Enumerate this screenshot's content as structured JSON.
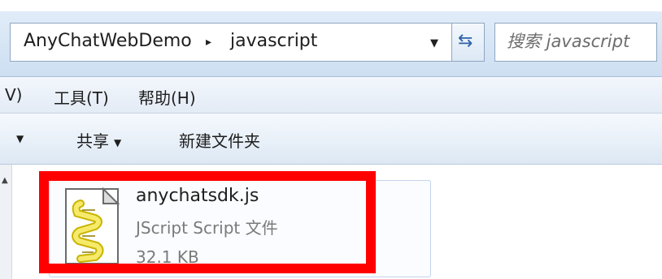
{
  "address": {
    "crumbs": [
      "AnyChatWebDemo",
      "javascript"
    ],
    "separator": "▸",
    "dropdown": "▼",
    "refresh_glyph": "⇆"
  },
  "search": {
    "placeholder": "搜索 javascript"
  },
  "menu": [
    {
      "label": "V)",
      "id": "view"
    },
    {
      "label": "工具(T)",
      "id": "tools"
    },
    {
      "label": "帮助(H)",
      "id": "help"
    }
  ],
  "toolbar": {
    "partial_arrow": "▼",
    "share_label": "共享",
    "share_arrow": "▼",
    "new_folder_label": "新建文件夹"
  },
  "file": {
    "name": "anychatsdk.js",
    "type": "JScript Script 文件",
    "size": "32.1 KB",
    "icon": "jscript-file-icon"
  },
  "colors": {
    "highlight": "#ff0000",
    "accent": "#2c62a8"
  }
}
